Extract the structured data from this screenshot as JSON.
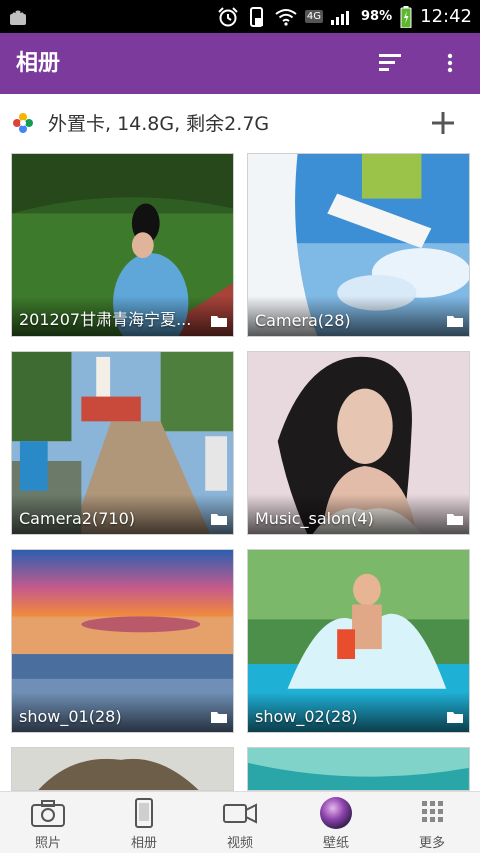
{
  "status_bar": {
    "network": "4G",
    "battery": "98%",
    "time": "12:42"
  },
  "action_bar": {
    "title": "相册",
    "sort_icon": "sort-icon",
    "more_icon": "overflow-menu-icon",
    "background": "#7b3a9c"
  },
  "storage": {
    "label": "外置卡, 14.8G, 剩余2.7G",
    "add_icon": "plus-icon"
  },
  "albums": [
    {
      "name": "201207甘肃青海宁夏..."
    },
    {
      "name": "Camera(28)"
    },
    {
      "name": "Camera2(710)"
    },
    {
      "name": "Music_salon(4)"
    },
    {
      "name": "show_01(28)"
    },
    {
      "name": "show_02(28)"
    },
    {
      "name": ""
    },
    {
      "name": ""
    }
  ],
  "bottom_nav": {
    "items": [
      {
        "label": "照片",
        "icon": "camera-icon"
      },
      {
        "label": "相册",
        "icon": "phone-album-icon"
      },
      {
        "label": "视频",
        "icon": "video-icon"
      },
      {
        "label": "壁纸",
        "icon": "wallpaper-icon"
      },
      {
        "label": "更多",
        "icon": "grid-more-icon"
      }
    ]
  }
}
